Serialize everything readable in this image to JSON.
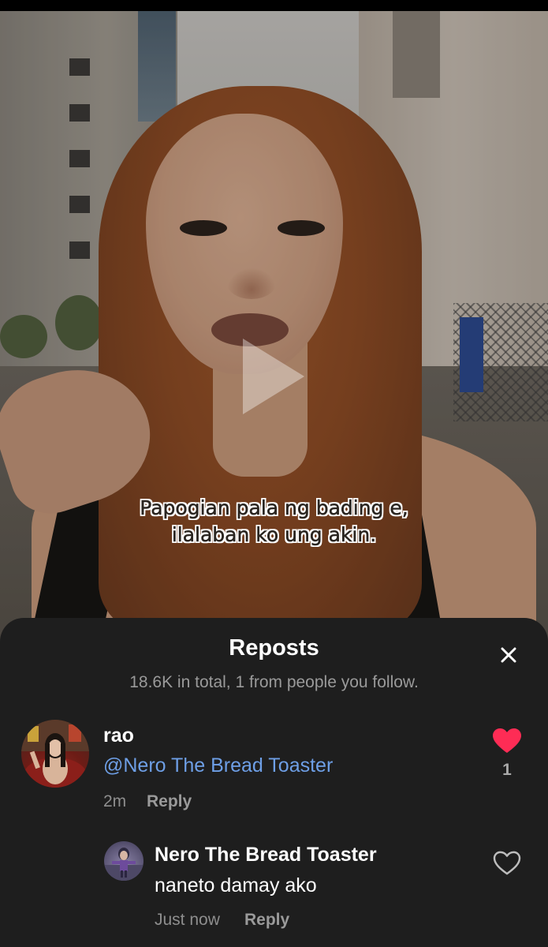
{
  "video": {
    "caption_line1": "Papogian pala ng bading e,",
    "caption_line2": "ilalaban ko ung akin."
  },
  "sheet": {
    "title": "Reposts",
    "subtitle": "18.6K in total, 1 from people you follow."
  },
  "comments": [
    {
      "username": "rao",
      "text": "@Nero The Bread Toaster",
      "time": "2m",
      "reply_label": "Reply",
      "likes": "1",
      "liked": true
    },
    {
      "username": "Nero The Bread Toaster",
      "text": "naneto damay ako",
      "time": "Just now",
      "reply_label": "Reply",
      "liked": false
    }
  ],
  "colors": {
    "sheet_bg": "#1e1e1e",
    "mention": "#6e9fe6",
    "like_active": "#fe2c55"
  },
  "icons": [
    "play-icon",
    "close-icon",
    "heart-filled-icon",
    "heart-outline-icon"
  ]
}
